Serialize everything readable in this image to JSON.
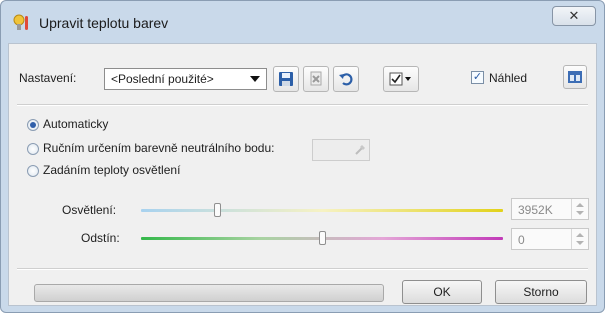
{
  "window": {
    "title": "Upravit teplotu barev",
    "close_glyph": "✕"
  },
  "toolbar": {
    "settings_label": "Nastavení:",
    "preset_value": "<Poslední použité>",
    "icons": [
      "save-icon",
      "delete-icon",
      "reset-icon",
      "options-menu-icon",
      "panel-layout-icon"
    ],
    "preview_label": "Náhled",
    "preview_checked": true
  },
  "mode": {
    "options": [
      {
        "label": "Automaticky",
        "selected": true
      },
      {
        "label": "Ručním určením barevně neutrálního bodu:",
        "selected": false
      },
      {
        "label": "Zadáním teploty osvětlení",
        "selected": false
      }
    ]
  },
  "sliders": {
    "lighting": {
      "label": "Osvětlení:",
      "value": "3952K",
      "position": 0.21
    },
    "tint": {
      "label": "Odstín:",
      "value": "0",
      "position": 0.5
    }
  },
  "footer": {
    "ok_label": "OK",
    "cancel_label": "Storno",
    "progress": 0
  },
  "colors": {
    "accent": "#2f5faa",
    "titlebar": "#c9d9ea"
  }
}
